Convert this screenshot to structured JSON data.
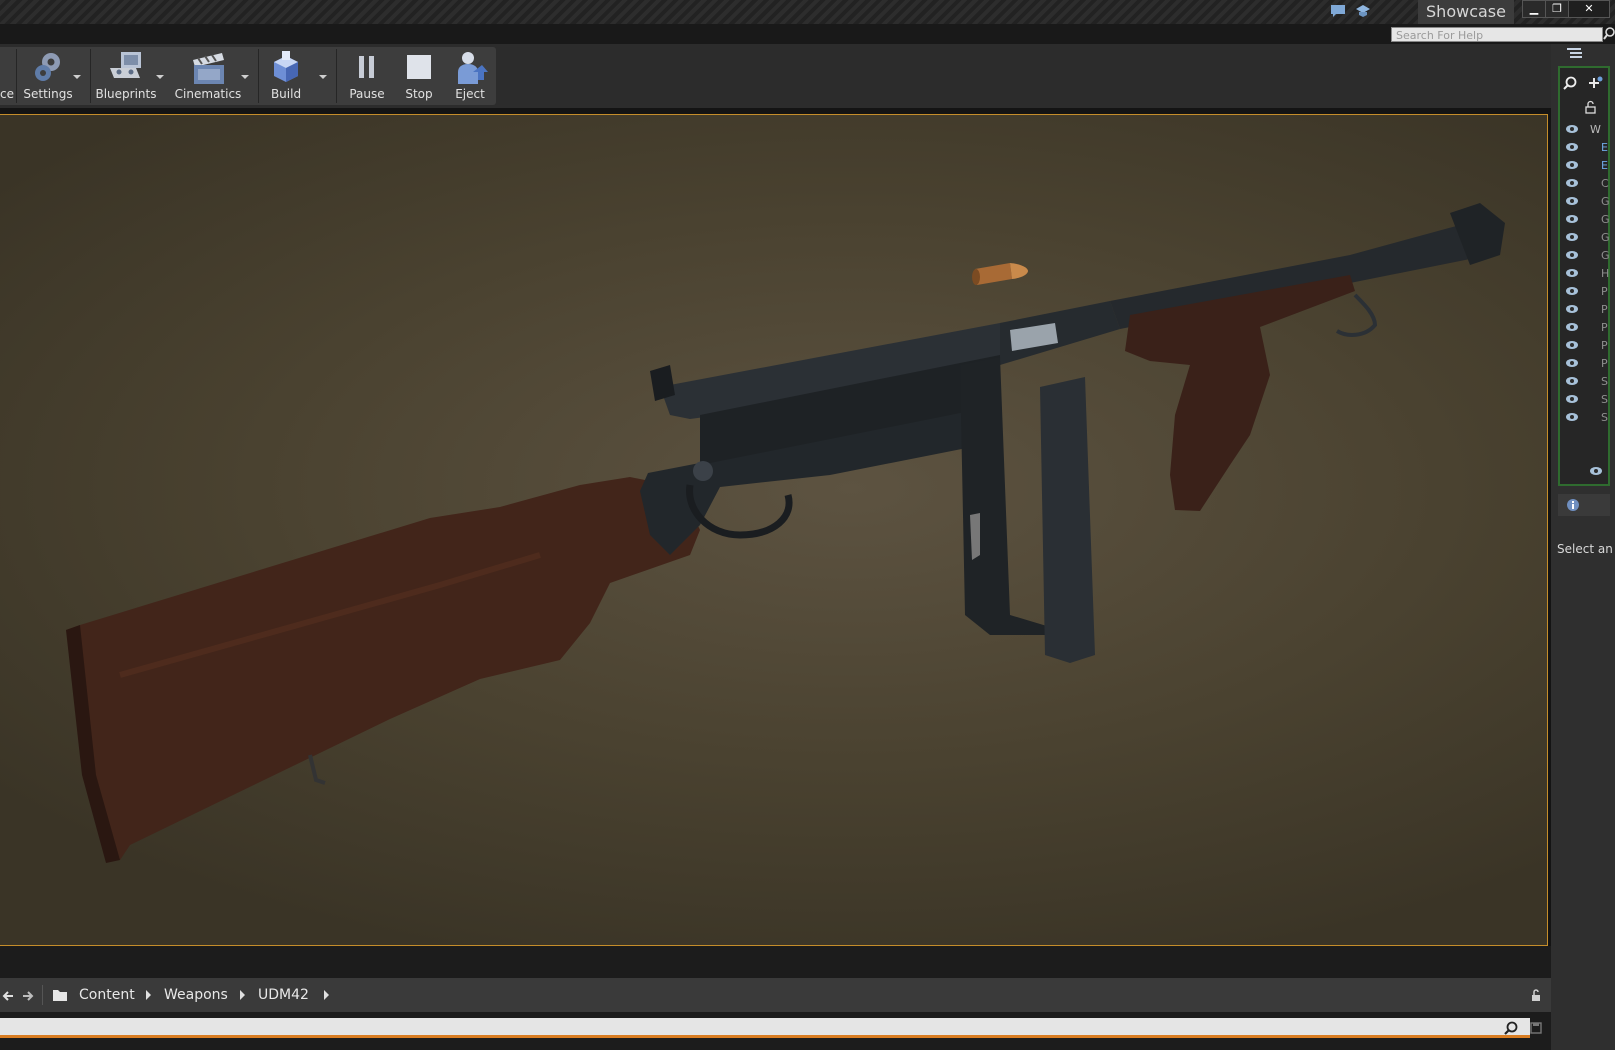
{
  "window": {
    "project_name": "Showcase",
    "controls": [
      "minimize-icon",
      "restore-icon",
      "close-icon"
    ]
  },
  "help_search": {
    "placeholder": "Search For Help"
  },
  "toolbar": {
    "cut_label": "ce",
    "buttons": [
      {
        "id": "settings",
        "label": "Settings",
        "icon": "settings-gears-icon",
        "has_dropdown": true
      },
      {
        "id": "blueprints",
        "label": "Blueprints",
        "icon": "blueprints-icon",
        "has_dropdown": true
      },
      {
        "id": "cinematics",
        "label": "Cinematics",
        "icon": "clapperboard-icon",
        "has_dropdown": true
      },
      {
        "id": "build",
        "label": "Build",
        "icon": "build-blocks-icon",
        "has_dropdown": true
      },
      {
        "id": "pause",
        "label": "Pause",
        "icon": "pause-icon",
        "has_dropdown": false
      },
      {
        "id": "stop",
        "label": "Stop",
        "icon": "stop-icon",
        "has_dropdown": false
      },
      {
        "id": "eject",
        "label": "Eject",
        "icon": "eject-icon",
        "has_dropdown": false
      }
    ]
  },
  "viewport": {
    "subject": "rifle-model",
    "accent_border": "#c58d2a"
  },
  "outliner": {
    "header_letter": "W",
    "rows": [
      "E",
      "E",
      "C",
      "G",
      "G",
      "G",
      "G",
      "H",
      "P",
      "P",
      "P",
      "P",
      "P",
      "S",
      "S",
      "S"
    ]
  },
  "details": {
    "message": "Select an"
  },
  "content_browser": {
    "breadcrumbs": [
      "Content",
      "Weapons",
      "UDM42"
    ]
  },
  "colors": {
    "search_underline": "#d97d22",
    "outliner_border": "#2f6b2f"
  }
}
